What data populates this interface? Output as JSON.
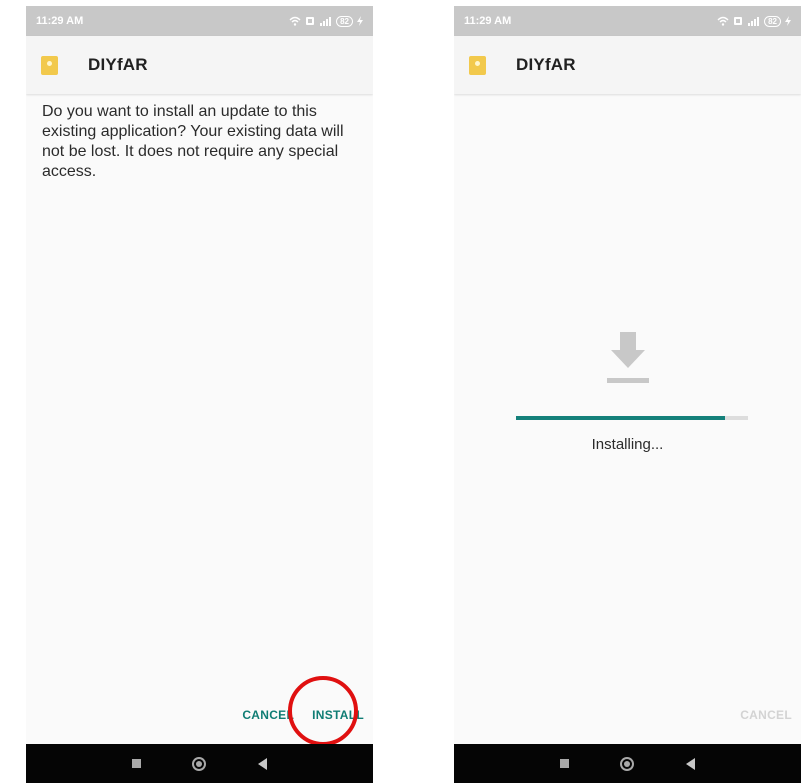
{
  "left_screen": {
    "status": {
      "time": "11:29 AM",
      "battery": "82"
    },
    "app_name": "DIYfAR",
    "message": "Do you want to install an update to this existing application? Your existing data will not be lost. It does not require any special access.",
    "buttons": {
      "cancel": "CANCEL",
      "install": "INSTALL"
    }
  },
  "right_screen": {
    "status": {
      "time": "11:29 AM",
      "battery": "82"
    },
    "app_name": "DIYfAR",
    "progress": {
      "fraction": 0.9,
      "label": "Installing..."
    },
    "buttons": {
      "cancel": "CANCEL"
    }
  },
  "colors": {
    "accent": "#0f7d74",
    "highlight": "#e01010",
    "statusbar": "#c8c8c8",
    "app_icon": "#f2c94c"
  },
  "icons": [
    "wifi-icon",
    "sim-icon",
    "signal-icon",
    "battery-icon",
    "charging-icon",
    "download-icon",
    "nav-recents-icon",
    "nav-home-icon",
    "nav-back-icon"
  ]
}
